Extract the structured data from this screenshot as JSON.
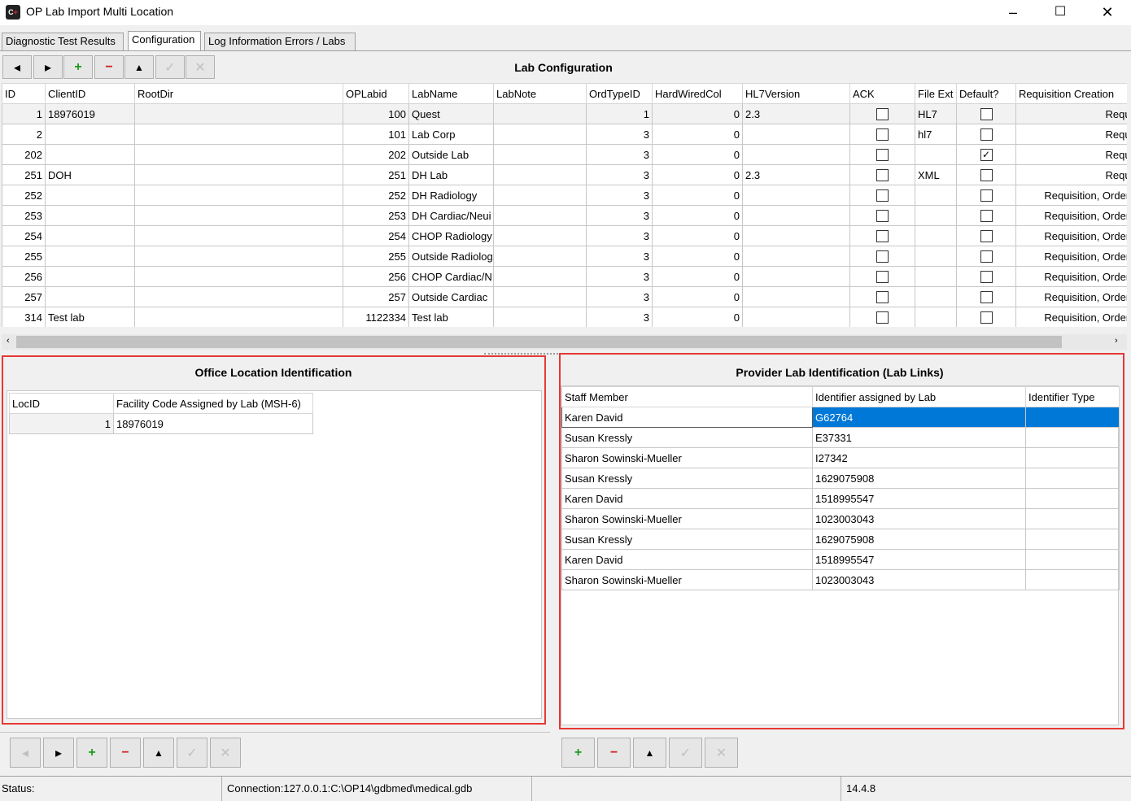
{
  "window": {
    "title": "OP Lab Import Multi Location",
    "minimize": "–",
    "maximize": "☐",
    "close": "✕"
  },
  "tabs": [
    "Diagnostic Test Results",
    "Configuration",
    "Log Information Errors / Labs"
  ],
  "lab_config": {
    "title": "Lab Configuration",
    "columns": [
      "ID",
      "ClientID",
      "RootDir",
      "OPLabid",
      "LabName",
      "LabNote",
      "OrdTypeID",
      "HardWiredCol",
      "HL7Version",
      "ACK",
      "File Ext",
      "Default?",
      "Requisition Creation"
    ],
    "rows": [
      [
        "1",
        "18976019",
        "",
        "100",
        "Quest",
        "",
        "1",
        "0",
        "2.3",
        "",
        "HL7",
        "",
        "Requis"
      ],
      [
        "2",
        "",
        "",
        "101",
        "Lab Corp",
        "",
        "3",
        "0",
        "",
        "",
        "hl7",
        "",
        "Requis"
      ],
      [
        "202",
        "",
        "",
        "202",
        "Outside Lab",
        "",
        "3",
        "0",
        "",
        "",
        "",
        "checked",
        "Requis"
      ],
      [
        "251",
        "DOH",
        "",
        "251",
        "DH Lab",
        "",
        "3",
        "0",
        "2.3",
        "",
        "XML",
        "",
        "Requis"
      ],
      [
        "252",
        "",
        "",
        "252",
        "DH Radiology",
        "",
        "3",
        "0",
        "",
        "",
        "",
        "",
        "Requisition, Order a"
      ],
      [
        "253",
        "",
        "",
        "253",
        "DH Cardiac/Neui",
        "",
        "3",
        "0",
        "",
        "",
        "",
        "",
        "Requisition, Order a"
      ],
      [
        "254",
        "",
        "",
        "254",
        "CHOP Radiology",
        "",
        "3",
        "0",
        "",
        "",
        "",
        "",
        "Requisition, Order a"
      ],
      [
        "255",
        "",
        "",
        "255",
        "Outside Radiolog",
        "",
        "3",
        "0",
        "",
        "",
        "",
        "",
        "Requisition, Order a"
      ],
      [
        "256",
        "",
        "",
        "256",
        "CHOP Cardiac/N",
        "",
        "3",
        "0",
        "",
        "",
        "",
        "",
        "Requisition, Order a"
      ],
      [
        "257",
        "",
        "",
        "257",
        "Outside Cardiac",
        "",
        "3",
        "0",
        "",
        "",
        "",
        "",
        "Requisition, Order a"
      ],
      [
        "314",
        "Test lab",
        "",
        "1122334",
        "Test lab",
        "",
        "3",
        "0",
        "",
        "",
        "",
        "",
        "Requisition, Order a"
      ]
    ]
  },
  "office_location": {
    "title": "Office Location Identification",
    "columns": [
      "LocID",
      "Facility Code Assigned by Lab (MSH-6)"
    ],
    "rows": [
      [
        "1",
        "18976019"
      ]
    ]
  },
  "provider_lab": {
    "title": "Provider Lab Identification (Lab Links)",
    "columns": [
      "Staff Member",
      "Identifier assigned by Lab",
      "Identifier Type"
    ],
    "rows": [
      [
        "Karen David",
        "G62764",
        ""
      ],
      [
        "Susan Kressly",
        "E37331",
        ""
      ],
      [
        "Sharon Sowinski-Mueller",
        "I27342",
        ""
      ],
      [
        "Susan Kressly",
        "1629075908",
        ""
      ],
      [
        "Karen David",
        "1518995547",
        ""
      ],
      [
        "Sharon Sowinski-Mueller",
        "1023003043",
        ""
      ],
      [
        "Susan Kressly",
        "1629075908",
        ""
      ],
      [
        "Karen David",
        "1518995547",
        ""
      ],
      [
        "Sharon Sowinski-Mueller",
        "1023003043",
        ""
      ]
    ]
  },
  "status": {
    "label": "Status:",
    "connection": "Connection:127.0.0.1:C:\\OP14\\gdbmed\\medical.gdb",
    "version": "14.4.8"
  },
  "colors": {
    "highlight": "#e53935",
    "selection": "#0078d7"
  }
}
